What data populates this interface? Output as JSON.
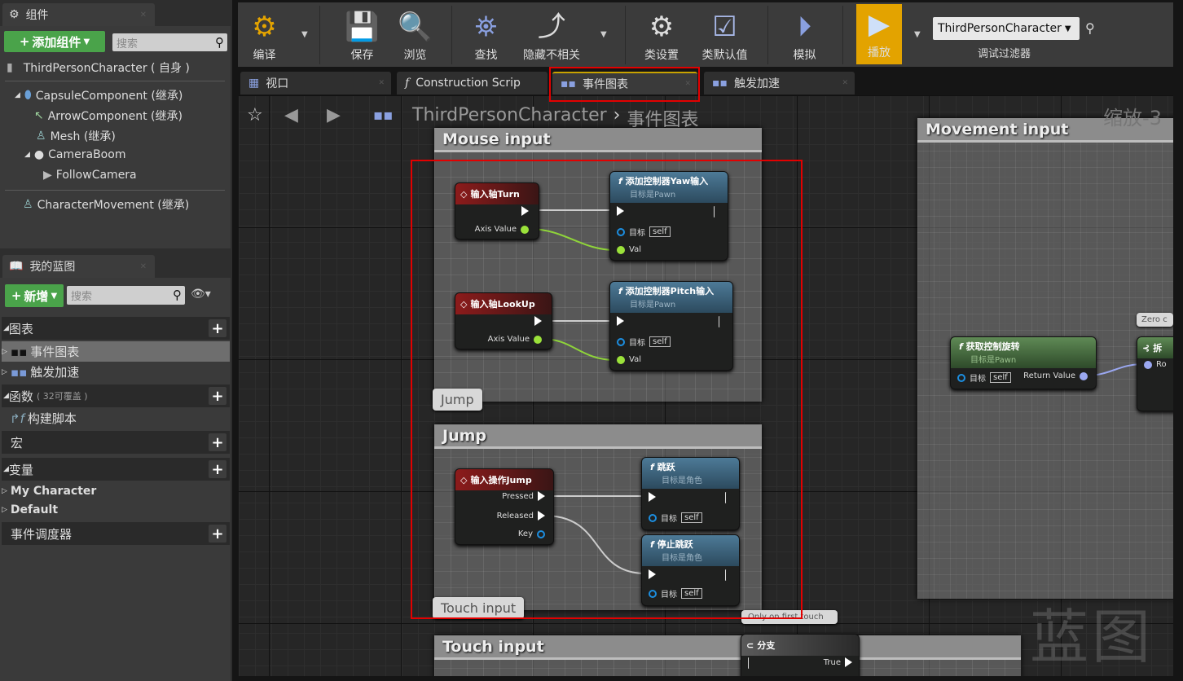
{
  "components_panel": {
    "tab_label": "组件",
    "add_button": "添加组件",
    "search_placeholder": "搜索",
    "root": "ThirdPersonCharacter ( 自身 )",
    "tree": [
      {
        "label": "CapsuleComponent (继承)",
        "icon": "capsule-icon"
      },
      {
        "label": "ArrowComponent (继承)",
        "icon": "arrow-icon"
      },
      {
        "label": "Mesh (继承)",
        "icon": "mesh-icon"
      },
      {
        "label": "CameraBoom",
        "icon": "spring-arm-icon"
      },
      {
        "label": "FollowCamera",
        "icon": "camera-icon"
      },
      {
        "label": "CharacterMovement (继承)",
        "icon": "movement-icon"
      }
    ]
  },
  "my_blueprint": {
    "tab_label": "我的蓝图",
    "add_button": "新增",
    "search_placeholder": "搜索",
    "graphs_header": "图表",
    "graphs": [
      "事件图表",
      "触发加速"
    ],
    "functions_header": "函数",
    "functions_note": "( 32可覆盖 )",
    "functions": [
      "构建脚本"
    ],
    "macros_header": "宏",
    "variables_header": "变量",
    "variable_categories": [
      "My Character",
      "Default"
    ],
    "dispatchers_header": "事件调度器"
  },
  "toolbar": {
    "compile": "编译",
    "save": "保存",
    "browse": "浏览",
    "find": "查找",
    "hide_unrelated": "隐藏不相关",
    "class_settings": "类设置",
    "class_defaults": "类默认值",
    "simulate": "模拟",
    "play": "播放",
    "debug_object": "ThirdPersonCharacter",
    "debug_filter": "调试过滤器",
    "play_color": "#e3a300"
  },
  "graph_tabs": [
    "视口",
    "Construction Scrip",
    "事件图表",
    "触发加速"
  ],
  "active_tab": "事件图表",
  "breadcrumb": {
    "root": "ThirdPersonCharacter",
    "sep": "›",
    "current": "事件图表"
  },
  "zoom_label": "缩放-3",
  "watermark": "蓝图",
  "comments": {
    "mouse": "Mouse input",
    "jump": "Jump",
    "touch": "Touch input",
    "movement": "Movement input",
    "zero": "Zero c",
    "first_touch": "Only on first touch"
  },
  "nodes": {
    "turn": {
      "title": "输入轴Turn",
      "pin": "Axis Value"
    },
    "yaw": {
      "title": "添加控制器Yaw输入",
      "subtitle": "目标是Pawn",
      "target": "目标",
      "self": "self",
      "val": "Val"
    },
    "lookup": {
      "title": "输入轴LookUp",
      "pin": "Axis Value"
    },
    "pitch": {
      "title": "添加控制器Pitch输入",
      "subtitle": "目标是Pawn",
      "target": "目标",
      "self": "self",
      "val": "Val"
    },
    "jump_ev": {
      "title": "输入操作Jump",
      "pressed": "Pressed",
      "released": "Released",
      "key": "Key"
    },
    "jump_fn": {
      "title": "跳跃",
      "subtitle": "目标是角色",
      "target": "目标",
      "self": "self"
    },
    "stop_fn": {
      "title": "停止跳跃",
      "subtitle": "目标是角色",
      "target": "目标",
      "self": "self"
    },
    "ctrl_rot": {
      "title": "获取控制旋转",
      "subtitle": "目标是Pawn",
      "target": "目标",
      "self": "self",
      "ret": "Return Value"
    },
    "break": {
      "title": "拆",
      "pin": "Ro"
    },
    "branch": {
      "title": "分支",
      "true": "True"
    }
  },
  "highlight_color": "#e30000"
}
